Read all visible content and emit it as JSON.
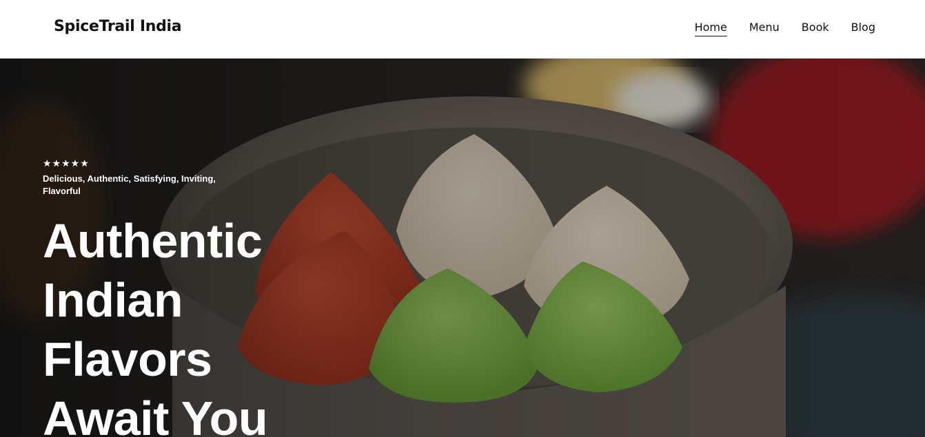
{
  "header": {
    "brand": "SpiceTrail India",
    "nav": [
      {
        "label": "Home",
        "active": true
      },
      {
        "label": "Menu",
        "active": false
      },
      {
        "label": "Book",
        "active": false
      },
      {
        "label": "Blog",
        "active": false
      }
    ]
  },
  "hero": {
    "rating_stars": "★★★★★",
    "rating_value": 5,
    "tagline": "Delicious, Authentic, Satisfying, Inviting, Flavorful",
    "headline": "Authentic Indian Flavors Await You",
    "background_image": "bowl of colorful modak sweets"
  },
  "colors": {
    "header_bg": "#ffffff",
    "text_dark": "#111111",
    "hero_text": "#ffffff"
  }
}
